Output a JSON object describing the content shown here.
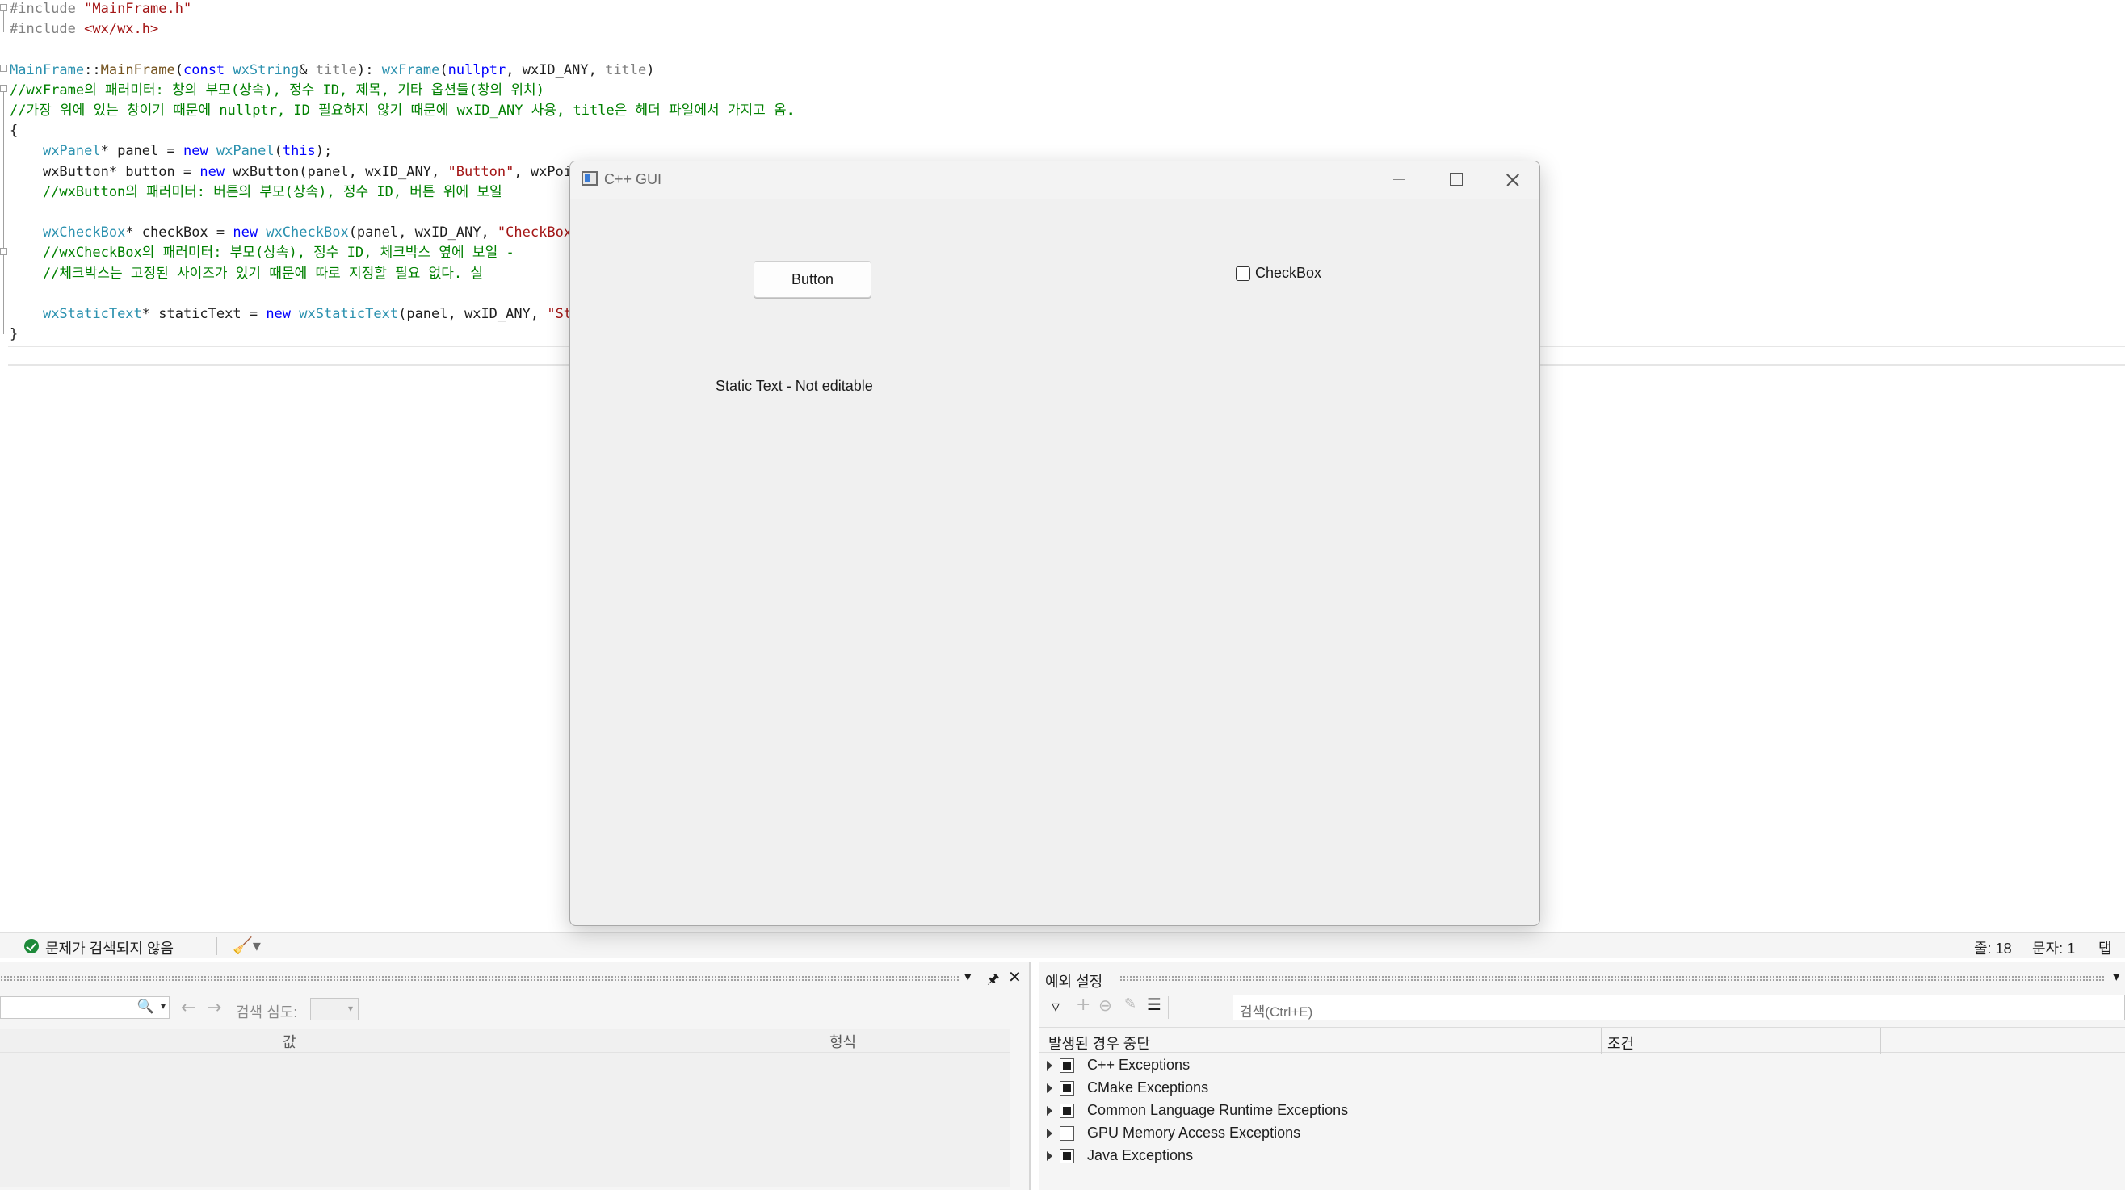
{
  "editor": {
    "lines": [
      {
        "parts": [
          {
            "t": "#include ",
            "c": "pp"
          },
          {
            "t": "\"MainFrame.h\"",
            "c": "str"
          }
        ]
      },
      {
        "parts": [
          {
            "t": "#include ",
            "c": "pp"
          },
          {
            "t": "<wx/wx.h>",
            "c": "str"
          }
        ]
      },
      {
        "parts": []
      },
      {
        "parts": [
          {
            "t": "MainFrame",
            "c": "type"
          },
          {
            "t": "::",
            "c": ""
          },
          {
            "t": "MainFrame",
            "c": "fn"
          },
          {
            "t": "(",
            "c": ""
          },
          {
            "t": "const ",
            "c": "kw"
          },
          {
            "t": "wxString",
            "c": "type"
          },
          {
            "t": "& ",
            "c": ""
          },
          {
            "t": "title",
            "c": "par"
          },
          {
            "t": "): ",
            "c": ""
          },
          {
            "t": "wxFrame",
            "c": "type"
          },
          {
            "t": "(",
            "c": ""
          },
          {
            "t": "nullptr",
            "c": "kw"
          },
          {
            "t": ", wxID_ANY, ",
            "c": ""
          },
          {
            "t": "title",
            "c": "par"
          },
          {
            "t": ")",
            "c": ""
          }
        ]
      },
      {
        "parts": [
          {
            "t": "//wxFrame의 패러미터: 창의 부모(상속), 정수 ID, 제목, 기타 옵션들(창의 위치)",
            "c": "cm"
          }
        ]
      },
      {
        "parts": [
          {
            "t": "//가장 위에 있는 창이기 때문에 nullptr, ID 필요하지 않기 때문에 wxID_ANY 사용, title은 헤더 파일에서 가지고 옴.",
            "c": "cm"
          }
        ]
      },
      {
        "parts": [
          {
            "t": "{",
            "c": ""
          }
        ]
      },
      {
        "parts": [
          {
            "t": "    ",
            "c": ""
          },
          {
            "t": "wxPanel",
            "c": "type"
          },
          {
            "t": "* panel = ",
            "c": ""
          },
          {
            "t": "new ",
            "c": "kw"
          },
          {
            "t": "wxPanel",
            "c": "type"
          },
          {
            "t": "(",
            "c": ""
          },
          {
            "t": "this",
            "c": "kw"
          },
          {
            "t": ");",
            "c": ""
          }
        ]
      },
      {
        "parts": [
          {
            "t": "    wxButton* button = ",
            "c": ""
          },
          {
            "t": "new ",
            "c": "kw"
          },
          {
            "t": "wxButton(panel, wxID_ANY, ",
            "c": ""
          },
          {
            "t": "\"Button\"",
            "c": "str"
          },
          {
            "t": ", wxPoin",
            "c": ""
          }
        ]
      },
      {
        "parts": [
          {
            "t": "    //wxButton의 패러미터: 버튼의 부모(상속), 정수 ID, 버튼 위에 보일",
            "c": "cm"
          }
        ]
      },
      {
        "parts": []
      },
      {
        "parts": [
          {
            "t": "    ",
            "c": ""
          },
          {
            "t": "wxCheckBox",
            "c": "type"
          },
          {
            "t": "* checkBox = ",
            "c": ""
          },
          {
            "t": "new ",
            "c": "kw"
          },
          {
            "t": "wxCheckBox",
            "c": "type"
          },
          {
            "t": "(panel, wxID_ANY, ",
            "c": ""
          },
          {
            "t": "\"CheckBox\"",
            "c": "str"
          }
        ]
      },
      {
        "parts": [
          {
            "t": "    //wxCheckBox의 패러미터: 부모(상속), 정수 ID, 체크박스 옆에 보일 -",
            "c": "cm"
          }
        ]
      },
      {
        "parts": [
          {
            "t": "    //체크박스는 고정된 사이즈가 있기 때문에 따로 지정할 필요 없다. 실",
            "c": "cm"
          }
        ]
      },
      {
        "parts": []
      },
      {
        "parts": [
          {
            "t": "    ",
            "c": ""
          },
          {
            "t": "wxStaticText",
            "c": "type"
          },
          {
            "t": "* staticText = ",
            "c": ""
          },
          {
            "t": "new ",
            "c": "kw"
          },
          {
            "t": "wxStaticText",
            "c": "type"
          },
          {
            "t": "(panel, wxID_ANY, ",
            "c": ""
          },
          {
            "t": "\"Sta",
            "c": "str"
          }
        ]
      },
      {
        "parts": [
          {
            "t": "}",
            "c": ""
          }
        ]
      }
    ]
  },
  "app_window": {
    "title": "C++ GUI",
    "button_label": "Button",
    "checkbox_label": "CheckBox",
    "checkbox_checked": false,
    "static_text": "Static Text - Not editable"
  },
  "statusbar": {
    "issues_text": "문제가 검색되지 않음",
    "line": "줄: 18",
    "char": "문자: 1",
    "mode": "탭"
  },
  "left_panel": {
    "search_depth_label": "검색 심도:",
    "col_value": "값",
    "col_type": "형식"
  },
  "right_panel": {
    "title": "예외 설정",
    "search_placeholder": "검색(Ctrl+E)",
    "col_break": "발생된 경우 중단",
    "col_condition": "조건",
    "items": [
      {
        "label": "C++ Exceptions",
        "checked": true
      },
      {
        "label": "CMake Exceptions",
        "checked": true
      },
      {
        "label": "Common Language Runtime Exceptions",
        "checked": true
      },
      {
        "label": "GPU Memory Access Exceptions",
        "checked": false
      },
      {
        "label": "Java Exceptions",
        "checked": true
      }
    ]
  },
  "colors": {
    "comment": "#008000",
    "keyword": "#0000ff",
    "type": "#2b91af",
    "string": "#a31515",
    "ok": "#1e8a3a"
  }
}
